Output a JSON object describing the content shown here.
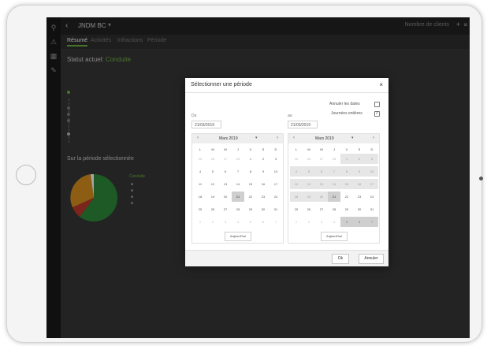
{
  "app": {
    "title": "JNDM BC",
    "title_caret": "▾",
    "back_icon": "back-arrow-icon",
    "right_text": "Nombre de clients",
    "right_icon_1": "+",
    "right_icon_2": "≡"
  },
  "sidebar": {
    "icons": [
      "⚲",
      "⚠",
      "▦",
      "✎"
    ]
  },
  "tabs": [
    {
      "label": "Résumé",
      "active": true
    },
    {
      "label": "Activités",
      "active": false
    },
    {
      "label": "Infractions",
      "active": false
    },
    {
      "label": "Période",
      "active": false
    }
  ],
  "summary": {
    "status_label": "Statut actuel:",
    "status_value": "Conduite",
    "section_title": "Sur la période sélectionnée",
    "legend_title": "Conduite"
  },
  "modal": {
    "title": "Sélectionner une période",
    "close": "×",
    "option_reset": "Annuler les dates",
    "option_full_days": "Journées entières",
    "option_full_days_checked": "✓",
    "from_label": "Du",
    "to_label": "au",
    "from_value": "21/03/2019",
    "to_value": "21/03/2019",
    "ok": "Ok",
    "cancel": "Annuler"
  },
  "calendar": {
    "month": "Mars 2019",
    "prev": "‹",
    "next": "›",
    "caret": "▾",
    "today": "Aujourd'hui",
    "weekdays": [
      "L",
      "M",
      "M",
      "J",
      "V",
      "S",
      "D"
    ],
    "weeks": [
      [
        "25",
        "26",
        "27",
        "28",
        "1",
        "2",
        "3"
      ],
      [
        "4",
        "5",
        "6",
        "7",
        "8",
        "9",
        "10"
      ],
      [
        "11",
        "12",
        "13",
        "14",
        "15",
        "16",
        "17"
      ],
      [
        "18",
        "19",
        "20",
        "21",
        "22",
        "23",
        "24"
      ],
      [
        "25",
        "26",
        "27",
        "28",
        "29",
        "30",
        "31"
      ],
      [
        "1",
        "2",
        "3",
        "4",
        "5",
        "6",
        "7"
      ]
    ],
    "selected_day": "21"
  },
  "colors": {
    "accent_green": "#6fb341",
    "pie_drive": "#2e8b3a",
    "pie_work": "#d8901c",
    "pie_rest": "#c0392b",
    "pie_other": "#ffffff"
  }
}
